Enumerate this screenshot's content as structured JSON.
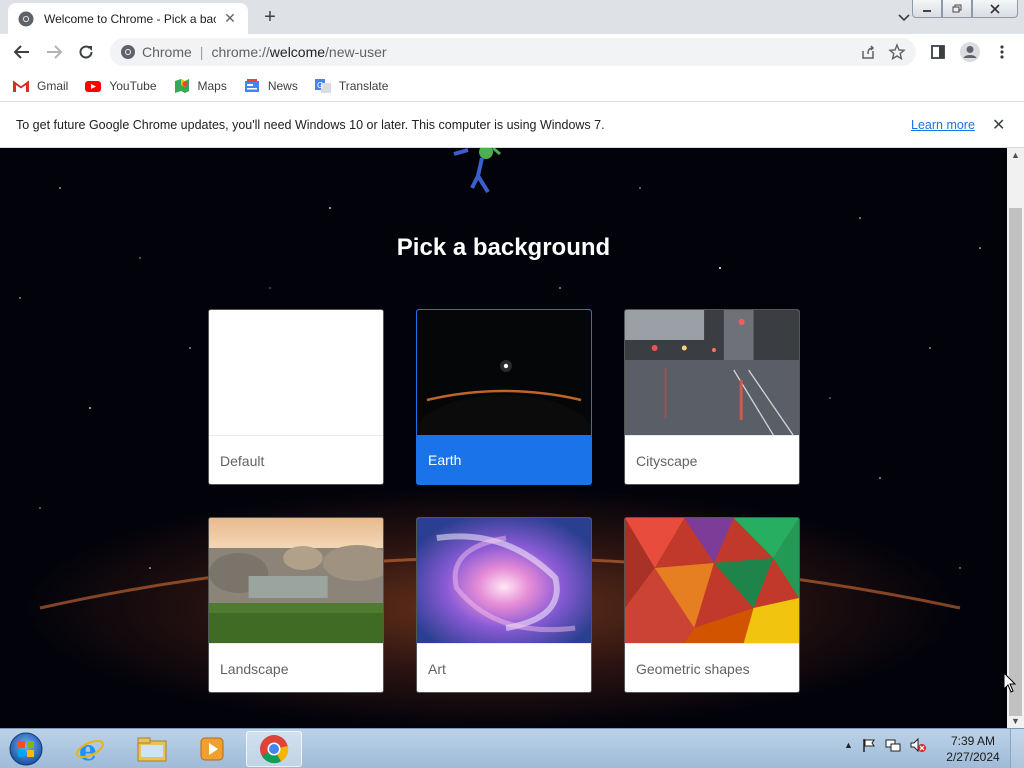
{
  "browser": {
    "tab_title": "Welcome to Chrome - Pick a background",
    "new_tab_symbol": "+",
    "close_tab_symbol": "✕",
    "omnibox_chip": "Chrome",
    "url_host": "chrome://",
    "url_path_bold": "welcome",
    "url_rest": "/new-user",
    "bookmarks": [
      {
        "label": "Gmail",
        "icon": "gmail-icon"
      },
      {
        "label": "YouTube",
        "icon": "youtube-icon"
      },
      {
        "label": "Maps",
        "icon": "maps-icon"
      },
      {
        "label": "News",
        "icon": "news-icon"
      },
      {
        "label": "Translate",
        "icon": "translate-icon"
      }
    ]
  },
  "infobar": {
    "message": "To get future Google Chrome updates, you'll need Windows 10 or later. This computer is using Windows 7.",
    "learn_more": "Learn more"
  },
  "page": {
    "heading": "Pick a background",
    "backgrounds": [
      {
        "label": "Default",
        "selected": false
      },
      {
        "label": "Earth",
        "selected": true
      },
      {
        "label": "Cityscape",
        "selected": false
      },
      {
        "label": "Landscape",
        "selected": false
      },
      {
        "label": "Art",
        "selected": false
      },
      {
        "label": "Geometric shapes",
        "selected": false
      }
    ]
  },
  "taskbar": {
    "time": "7:39 AM",
    "date": "2/27/2024",
    "apps": [
      "internet-explorer",
      "windows-explorer",
      "media-player",
      "chrome"
    ]
  },
  "colors": {
    "accent": "#1a73e8",
    "tabstrip": "#dee1e6",
    "taskbar": "#a9c3de"
  }
}
